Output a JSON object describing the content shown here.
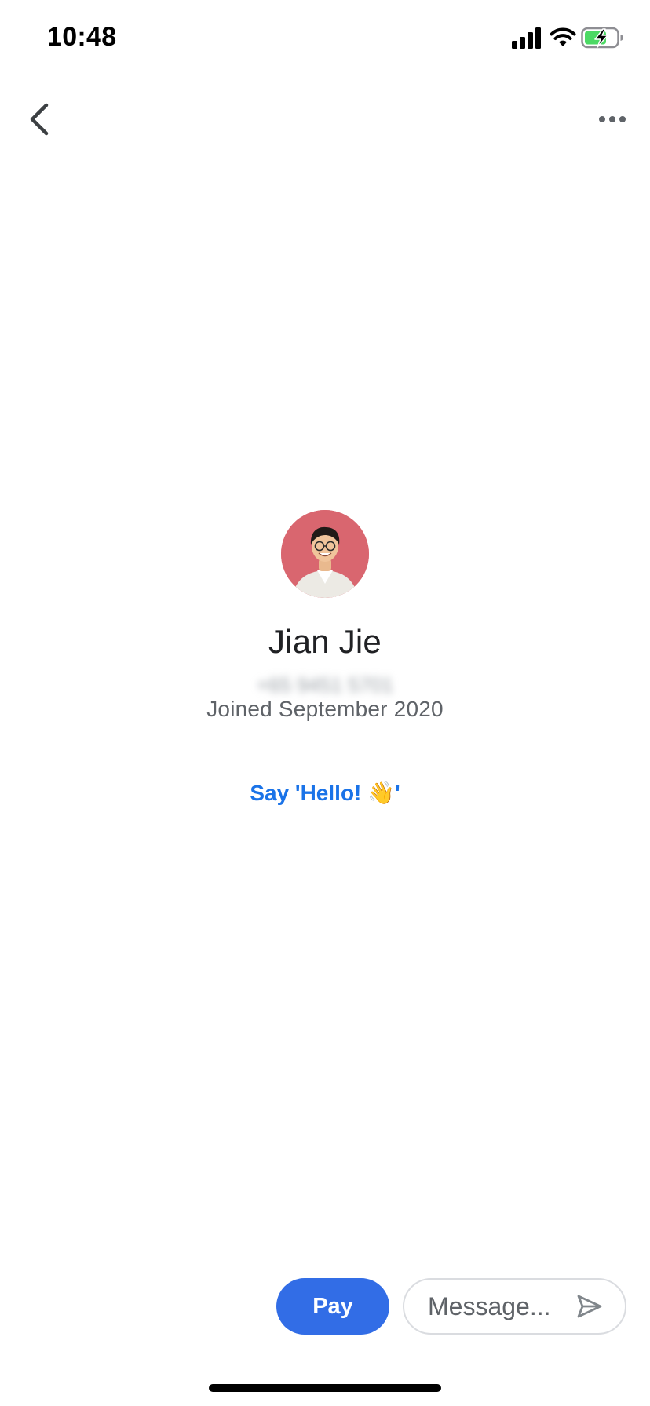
{
  "status_bar": {
    "time": "10:48",
    "icons": [
      "signal-icon",
      "wifi-icon",
      "battery-charging-icon"
    ]
  },
  "nav": {
    "back_icon": "chevron-left-icon",
    "more_icon": "more-horizontal-icon"
  },
  "contact": {
    "name": "Jian Jie",
    "phone": "+65 9451 5701",
    "joined": "Joined September 2020",
    "avatar_bg": "#d9666f"
  },
  "greeting": {
    "label": "Say 'Hello! 👋'"
  },
  "composer": {
    "pay_label": "Pay",
    "message_placeholder": "Message...",
    "message_value": "",
    "send_icon": "send-icon"
  },
  "colors": {
    "accent": "#326de6",
    "link": "#1a73e8",
    "battery_green": "#4cd964"
  }
}
